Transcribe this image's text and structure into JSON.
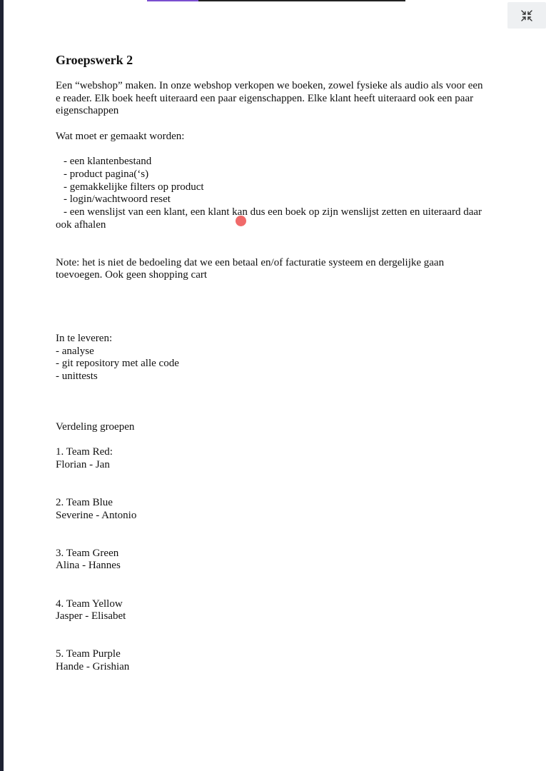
{
  "viewer": {
    "progress_fraction": 0.2,
    "exit_icon": "collapse-arrows-icon",
    "accent_color": "#7a4fd0",
    "pointer_color": "#f06a6a"
  },
  "document": {
    "title": "Groepswerk 2",
    "intro_lines": [
      "Een “webshop” maken. In onze webshop verkopen we boeken, zowel fysieke als audio als voor een",
      "e reader. Elk boek heeft uiteraard een paar eigenschappen. Elke klant heeft uiteraard ook een paar",
      "eigenschappen"
    ],
    "requirements_heading": "Wat moet er gemaakt worden:",
    "requirements": [
      "- een klantenbestand",
      "- product pagina(‘s)",
      "- gemakkelijke filters op product",
      "- login/wachtwoord reset",
      "- een wenslijst van een klant, een klant kan dus een boek op zijn wenslijst zetten en uiteraard daar"
    ],
    "requirements_continuation": "ook afhalen",
    "note_lines": [
      "Note: het is niet de bedoeling dat we een betaal en/of facturatie systeem en dergelijke gaan",
      "toevoegen. Ook geen shopping cart"
    ],
    "deliverables_heading": "In te leveren:",
    "deliverables": [
      "- analyse",
      "- git repository met alle code",
      "- unittests"
    ],
    "groups_heading": "Verdeling groepen",
    "teams": [
      {
        "name": "1.  Team Red:",
        "members": "Florian - Jan"
      },
      {
        "name": "2. Team Blue",
        "members": "Severine - Antonio"
      },
      {
        "name": "3. Team Green",
        "members": "Alina - Hannes"
      },
      {
        "name": "4. Team Yellow",
        "members": "Jasper - Elisabet"
      },
      {
        "name": "5. Team Purple",
        "members": "Hande - Grishian"
      }
    ]
  }
}
